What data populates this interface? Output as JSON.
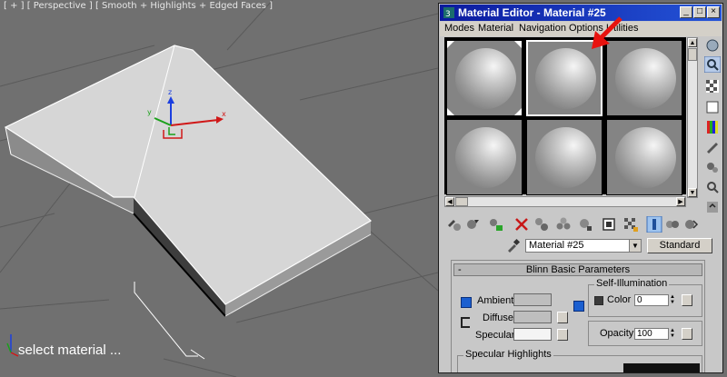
{
  "viewport": {
    "label": "[ + ] [ Perspective ] [ Smooth + Highlights + Edged Faces ]",
    "caption": "select material ...",
    "axis_x": "x",
    "axis_y": "y",
    "axis_z": "z"
  },
  "editor": {
    "title": "Material Editor - Material #25",
    "menu": [
      "Modes",
      "Material",
      "Navigation",
      "Options",
      "Utilities"
    ],
    "selected_slot": 2,
    "material_name": "Material #25",
    "material_type": "Standard",
    "rollout": {
      "title": "Blinn Basic Parameters",
      "ambient_label": "Ambient:",
      "diffuse_label": "Diffuse:",
      "specular_label": "Specular:",
      "self_illum_title": "Self-Illumination",
      "color_label": "Color",
      "color_value": "0",
      "opacity_label": "Opacity:",
      "opacity_value": "100",
      "specular_highlights_title": "Specular Highlights"
    }
  },
  "colors": {
    "annotation_arrow": "#e8130f",
    "titlebar": "#0b1a9e",
    "swatch_gray": "#bebebe",
    "swatch_white": "#f4f4f4"
  },
  "icons": {
    "slot_tools": [
      "get-material-icon",
      "put-to-scene-icon",
      "assign-to-selection-icon",
      "delete-icon",
      "make-copy-icon",
      "make-unique-icon",
      "put-to-library-icon",
      "material-id-icon",
      "show-map-icon",
      "show-end-result-icon",
      "go-to-parent-icon",
      "go-forward-icon"
    ],
    "side_tools": [
      "sample-type-icon",
      "backlight-icon",
      "background-icon",
      "uv-tiling-icon",
      "video-color-check-icon",
      "make-preview-icon",
      "options-icon",
      "select-by-material-icon",
      "material-navigator-icon"
    ]
  }
}
